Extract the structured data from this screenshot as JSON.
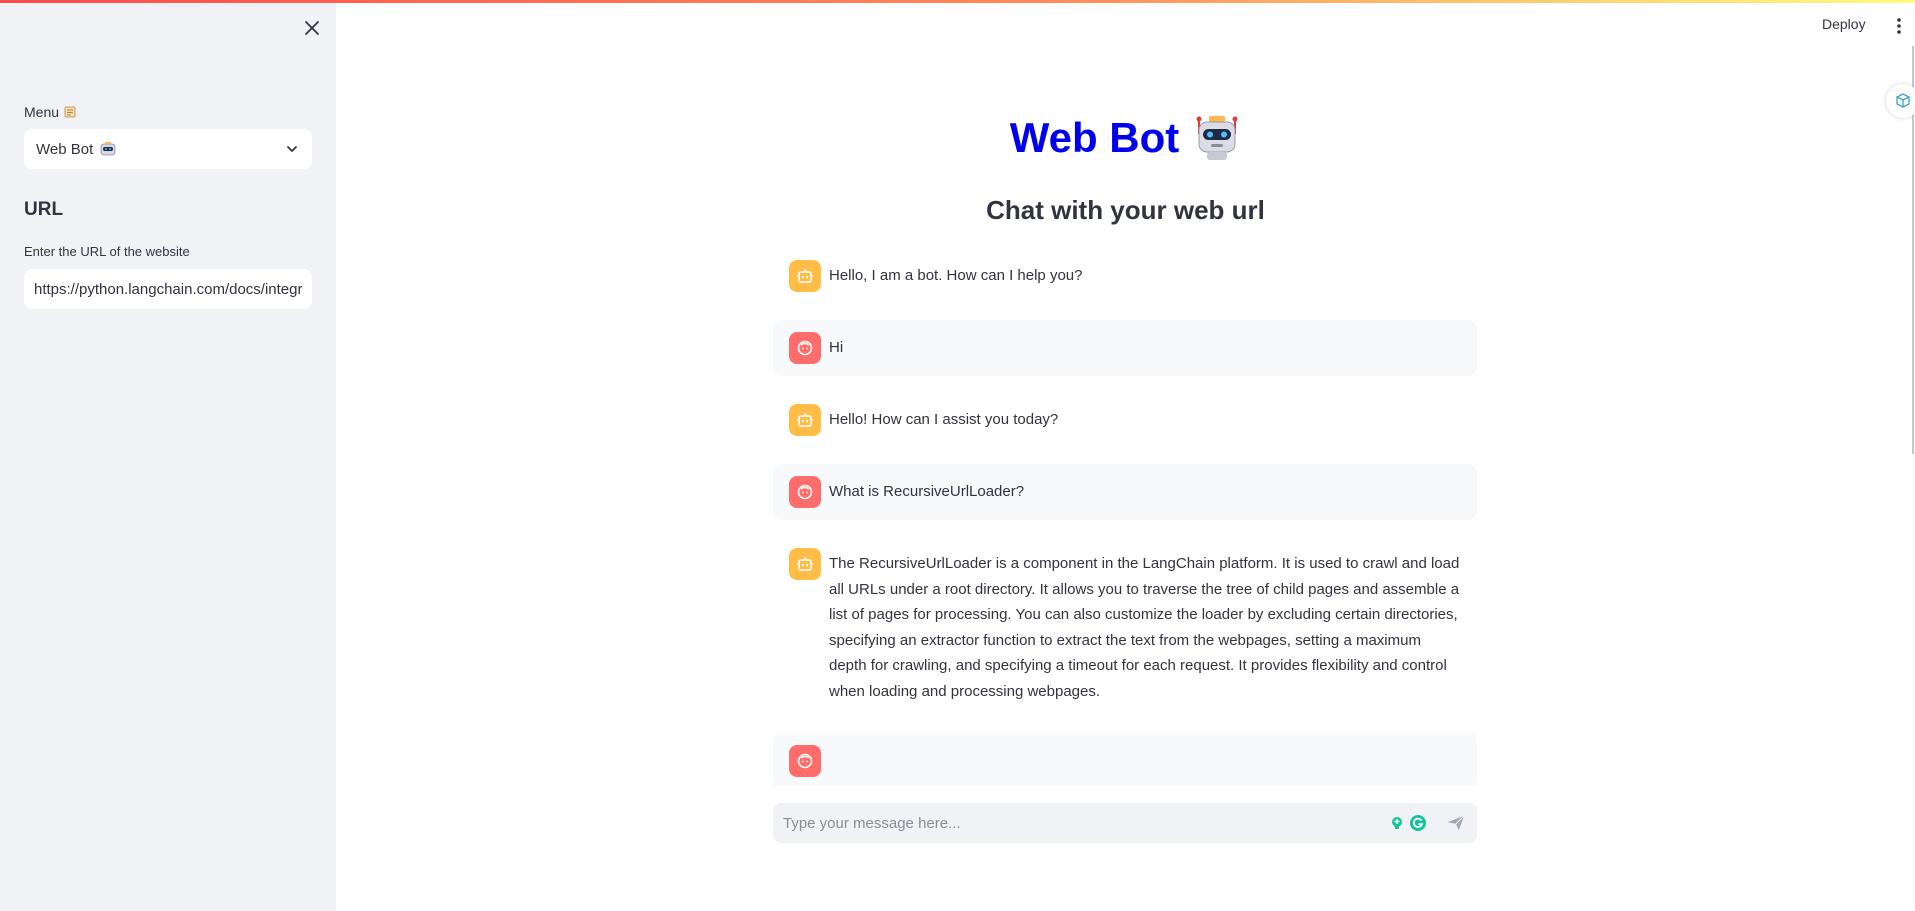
{
  "sidebar": {
    "menu_label": "Menu",
    "menu_select_value": "Web Bot",
    "section_heading": "URL",
    "url_label": "Enter the URL of the website",
    "url_value": "https://python.langchain.com/docs/integrations/document_loaders/recursive_url"
  },
  "header": {
    "deploy_label": "Deploy"
  },
  "main": {
    "title": "Web Bot",
    "subtitle": "Chat with your web url",
    "messages": [
      {
        "role": "bot",
        "text": "Hello, I am a bot. How can I help you?"
      },
      {
        "role": "user",
        "text": "Hi"
      },
      {
        "role": "bot",
        "text": "Hello! How can I assist you today?"
      },
      {
        "role": "user",
        "text": "What is RecursiveUrlLoader?"
      },
      {
        "role": "bot",
        "text": "The RecursiveUrlLoader is a component in the LangChain platform. It is used to crawl and load all URLs under a root directory. It allows you to traverse the tree of child pages and assemble a list of pages for processing. You can also customize the loader by excluding certain directories, specifying an extractor function to extract the text from the webpages, setting a maximum depth for crawling, and specifying a timeout for each request. It provides flexibility and control when loading and processing webpages."
      },
      {
        "role": "user",
        "text": ""
      }
    ],
    "chat_placeholder": "Type your message here..."
  },
  "colors": {
    "title": "#0000ee",
    "bot_avatar": "#ffbd45",
    "user_avatar": "#ff6c6c",
    "sidebar_bg": "#f0f2f6"
  },
  "icons": [
    "close-icon",
    "scroll-emoji-icon",
    "robot-emoji-icon",
    "chevron-down-icon",
    "kebab-menu-icon",
    "bot-avatar-icon",
    "user-avatar-icon",
    "send-icon",
    "grammarly-icon"
  ]
}
